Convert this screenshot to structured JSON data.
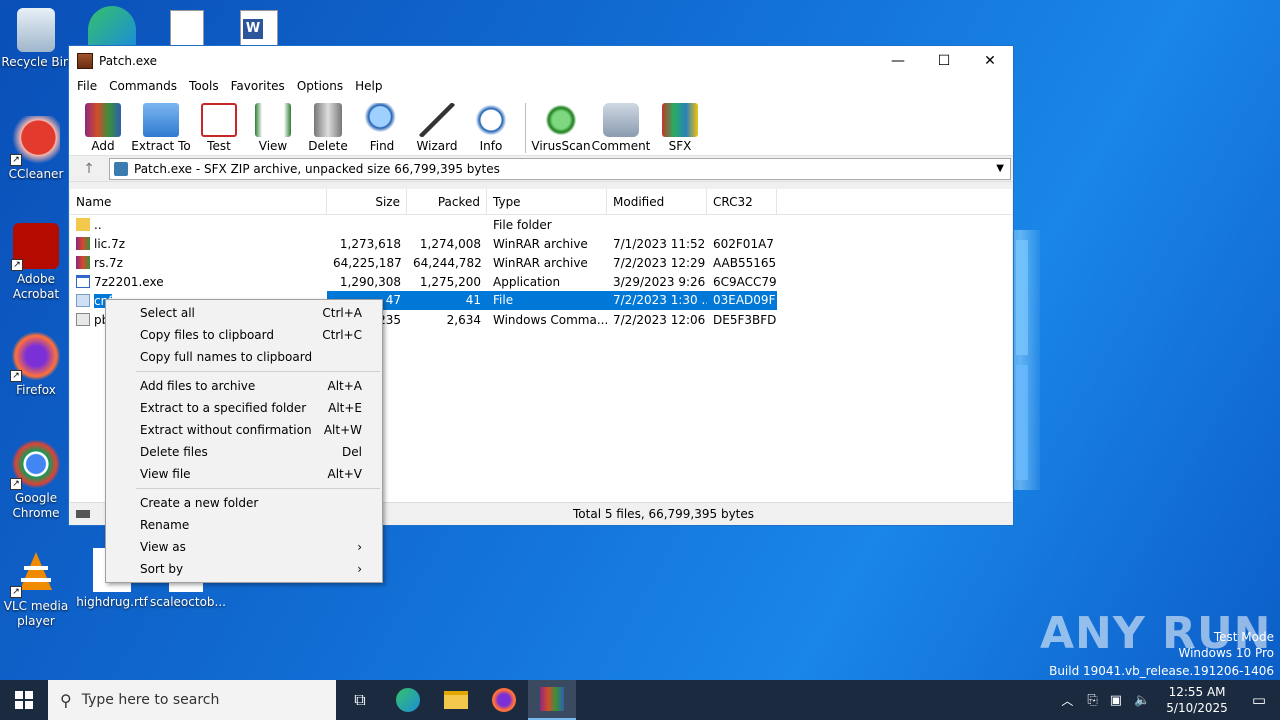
{
  "desktop": {
    "icons": [
      {
        "label": "Recycle Bin"
      },
      {
        "label": "CCleaner"
      },
      {
        "label": "Adobe Acrobat"
      },
      {
        "label": "Firefox"
      },
      {
        "label": "Google Chrome"
      },
      {
        "label": "VLC media player"
      },
      {
        "label": "highdrug.rtf"
      },
      {
        "label": "scaleoctob..."
      }
    ]
  },
  "window": {
    "title": "Patch.exe",
    "menu": [
      "File",
      "Commands",
      "Tools",
      "Favorites",
      "Options",
      "Help"
    ],
    "toolbar": [
      "Add",
      "Extract To",
      "Test",
      "View",
      "Delete",
      "Find",
      "Wizard",
      "Info",
      "VirusScan",
      "Comment",
      "SFX"
    ],
    "address": "Patch.exe - SFX ZIP archive, unpacked size 66,799,395 bytes",
    "columns": [
      "Name",
      "Size",
      "Packed",
      "Type",
      "Modified",
      "CRC32"
    ],
    "rows": [
      {
        "name": "..",
        "size": "",
        "packed": "",
        "type": "File folder",
        "modified": "",
        "crc": ""
      },
      {
        "name": "lic.7z",
        "size": "1,273,618",
        "packed": "1,274,008",
        "type": "WinRAR archive",
        "modified": "7/1/2023 11:52 ...",
        "crc": "602F01A7"
      },
      {
        "name": "rs.7z",
        "size": "64,225,187",
        "packed": "64,244,782",
        "type": "WinRAR archive",
        "modified": "7/2/2023 12:29 ...",
        "crc": "AAB55165"
      },
      {
        "name": "7z2201.exe",
        "size": "1,290,308",
        "packed": "1,275,200",
        "type": "Application",
        "modified": "3/29/2023 9:26 ...",
        "crc": "6C9ACC79"
      },
      {
        "name": "cnf",
        "size": "47",
        "packed": "41",
        "type": "File",
        "modified": "7/2/2023 1:30 ...",
        "crc": "03EAD09F"
      },
      {
        "name": "pb",
        "size": "235",
        "packed": "2,634",
        "type": "Windows Comma...",
        "modified": "7/2/2023 12:06 ...",
        "crc": "DE5F3BFD"
      }
    ],
    "status": "Total 5 files, 66,799,395 bytes"
  },
  "context_menu": [
    {
      "label": "Select all",
      "key": "Ctrl+A"
    },
    {
      "label": "Copy files to clipboard",
      "key": "Ctrl+C"
    },
    {
      "label": "Copy full names to clipboard",
      "key": ""
    },
    {
      "label": "Add files to archive",
      "key": "Alt+A"
    },
    {
      "label": "Extract to a specified folder",
      "key": "Alt+E"
    },
    {
      "label": "Extract without confirmation",
      "key": "Alt+W"
    },
    {
      "label": "Delete files",
      "key": "Del"
    },
    {
      "label": "View file",
      "key": "Alt+V"
    },
    {
      "label": "Create a new folder",
      "key": ""
    },
    {
      "label": "Rename",
      "key": ""
    },
    {
      "label": "View as",
      "key": "›"
    },
    {
      "label": "Sort by",
      "key": "›"
    }
  ],
  "taskbar": {
    "search_placeholder": "Type here to search",
    "time": "12:55 AM",
    "date": "5/10/2025"
  },
  "watermark": {
    "line1": "Test Mode",
    "line2": "Windows 10 Pro",
    "line3": "Build 19041.vb_release.191206-1406",
    "brand": "ANY RUN"
  }
}
